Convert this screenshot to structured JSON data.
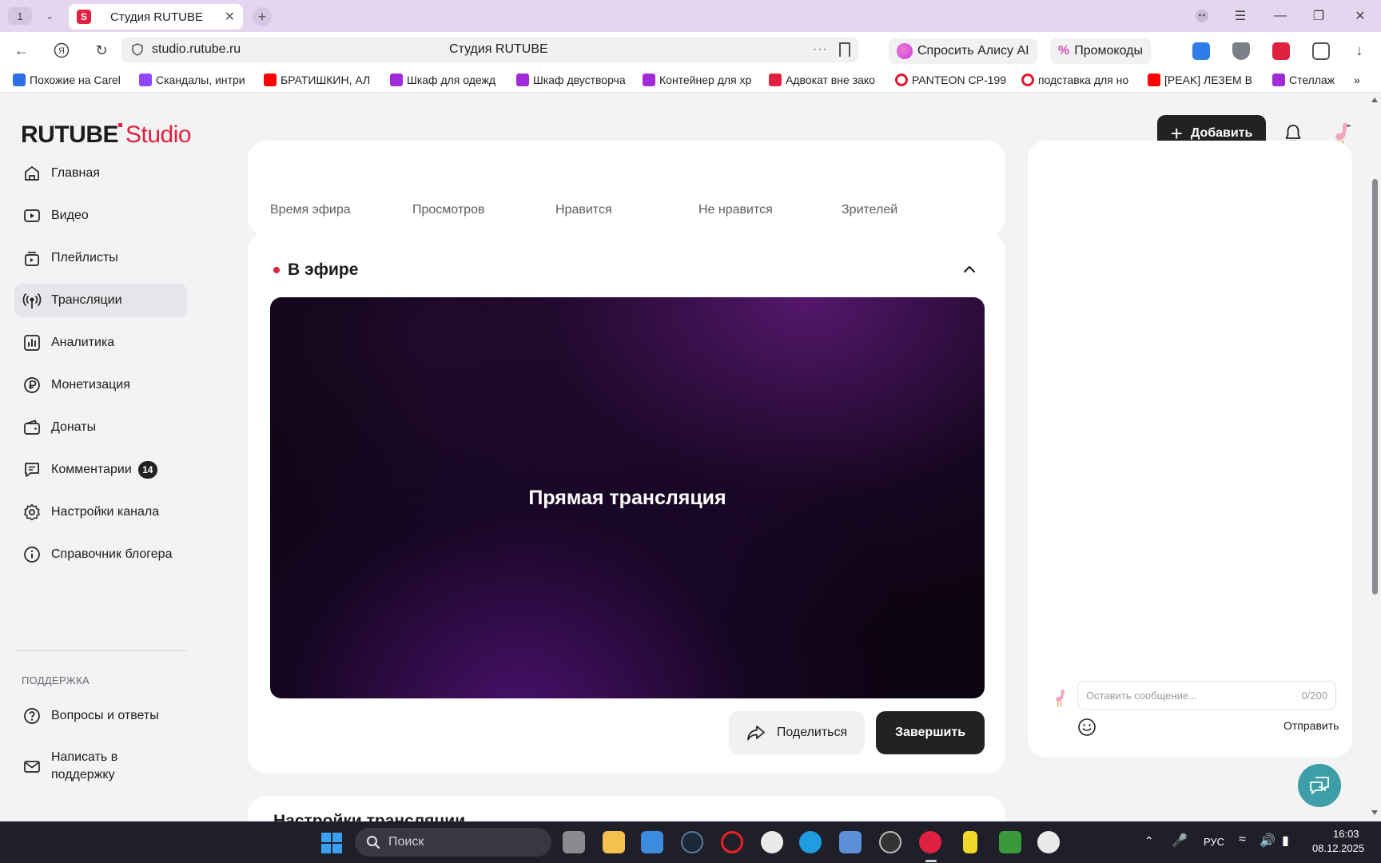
{
  "browser": {
    "tab_count": "1",
    "active_tab": {
      "title": "Студия RUTUBE"
    },
    "url": "studio.rutube.ru",
    "page_title": "Студия RUTUBE",
    "more_label": "···",
    "alice_label": "Спросить Алису AI",
    "promo_label": "Промокоды",
    "bookmarks": [
      {
        "label": "Похожие на Carel",
        "icon": "blue-play-icon"
      },
      {
        "label": "Скандалы, интри",
        "icon": "twitch-icon"
      },
      {
        "label": "БРАТИШКИН, АЛ",
        "icon": "youtube-icon"
      },
      {
        "label": "Шкаф для одежд",
        "icon": "wildberries-icon"
      },
      {
        "label": "Шкаф двустворча",
        "icon": "wildberries-icon"
      },
      {
        "label": "Контейнер для хр",
        "icon": "wildberries-icon"
      },
      {
        "label": "Адвокат вне зако",
        "icon": "rutube-icon"
      },
      {
        "label": "PANTEON CP-199",
        "icon": "ozon-icon"
      },
      {
        "label": "подставка для но",
        "icon": "ozon-icon"
      },
      {
        "label": "[PEAK] ЛЕЗЕМ В",
        "icon": "youtube-icon"
      },
      {
        "label": "Стеллаж",
        "icon": "wildberries-icon"
      }
    ],
    "bookmarks_more": "»"
  },
  "studio": {
    "logo_main": "RUTUBE",
    "logo_studio": "Studio",
    "add_button": "Добавить",
    "sidebar": {
      "items": [
        {
          "label": "Главная",
          "icon": "home-icon"
        },
        {
          "label": "Видео",
          "icon": "video-icon"
        },
        {
          "label": "Плейлисты",
          "icon": "playlist-icon"
        },
        {
          "label": "Трансляции",
          "icon": "broadcast-icon",
          "active": true
        },
        {
          "label": "Аналитика",
          "icon": "analytics-icon"
        },
        {
          "label": "Монетизация",
          "icon": "ruble-icon"
        },
        {
          "label": "Донаты",
          "icon": "wallet-icon"
        },
        {
          "label": "Комментарии",
          "icon": "comments-icon",
          "badge": "14"
        },
        {
          "label": "Настройки канала",
          "icon": "gear-icon"
        },
        {
          "label": "Справочник блогера",
          "icon": "info-icon"
        }
      ],
      "support_heading": "ПОДДЕРЖКА",
      "support_items": [
        {
          "label": "Вопросы и ответы",
          "icon": "question-icon"
        },
        {
          "label": "Написать в поддержку",
          "icon": "mail-icon"
        }
      ]
    },
    "stats": {
      "labels": [
        "Время эфира",
        "Просмотров",
        "Нравится",
        "Не нравится",
        "Зрителей"
      ]
    },
    "live": {
      "title": "В эфире",
      "player_label": "Прямая трансляция",
      "share_button": "Поделиться",
      "finish_button": "Завершить"
    },
    "settings": {
      "title": "Настройки трансляции"
    },
    "chat": {
      "placeholder": "Оставить сообщение...",
      "counter": "0/200",
      "send_button": "Отправить"
    }
  },
  "taskbar": {
    "search_placeholder": "Поиск",
    "language": "РУС",
    "time": "16:03",
    "date": "08.12.2025"
  },
  "colors": {
    "accent": "#e0213f",
    "dark_button": "#222222",
    "sidebar_active": "#e6e6ea"
  }
}
